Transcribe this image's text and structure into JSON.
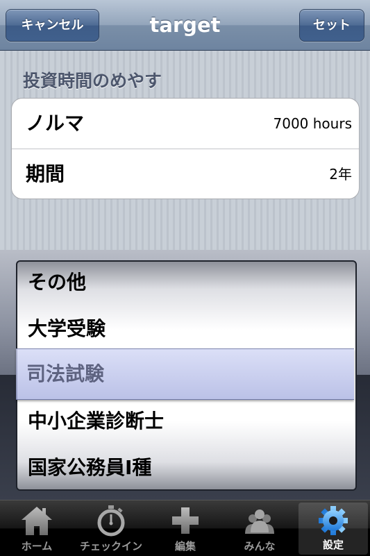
{
  "nav": {
    "title": "target",
    "cancel_label": "キャンセル",
    "set_label": "セット"
  },
  "section": {
    "header": "投資時間のめやす",
    "rows": [
      {
        "label": "ノルマ",
        "value": "7000 hours"
      },
      {
        "label": "期間",
        "value": "2年"
      }
    ]
  },
  "picker": {
    "items": [
      "その他",
      "大学受験",
      "司法試験",
      "中小企業診断士",
      "国家公務員I種"
    ],
    "selected": "司法試験"
  },
  "tabbar": {
    "tabs": [
      {
        "label": "ホーム",
        "icon": "home-icon"
      },
      {
        "label": "チェックイン",
        "icon": "stopwatch-icon"
      },
      {
        "label": "編集",
        "icon": "plus-icon"
      },
      {
        "label": "みんな",
        "icon": "people-icon"
      },
      {
        "label": "設定",
        "icon": "gear-icon"
      }
    ],
    "selected_index": 4,
    "accent": "#2f8fe8"
  }
}
